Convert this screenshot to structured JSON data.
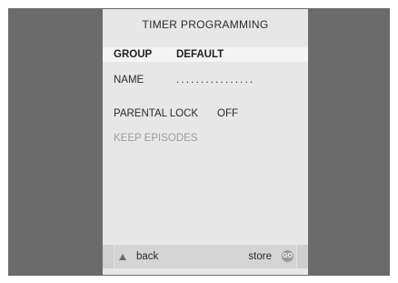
{
  "screen": {
    "title": "TIMER PROGRAMMING"
  },
  "fields": {
    "group": {
      "label": "GROUP",
      "value": "DEFAULT"
    },
    "name": {
      "label": "NAME",
      "value": "................"
    },
    "parental_lock": {
      "label": "PARENTAL LOCK",
      "value": "OFF"
    },
    "keep_episodes": {
      "label": "KEEP EPISODES"
    }
  },
  "footer": {
    "back_label": "back",
    "store_label": "store",
    "up_icon": "up-arrow-icon",
    "go_icon": "go-button-icon",
    "go_text": "GO"
  },
  "colors": {
    "background_frame": "#6b6b6b",
    "panel": "#e7e7e7",
    "selected_row": "#f4f4f4",
    "footer": "#d4d4d4",
    "disabled_text": "#9d9d9d"
  }
}
